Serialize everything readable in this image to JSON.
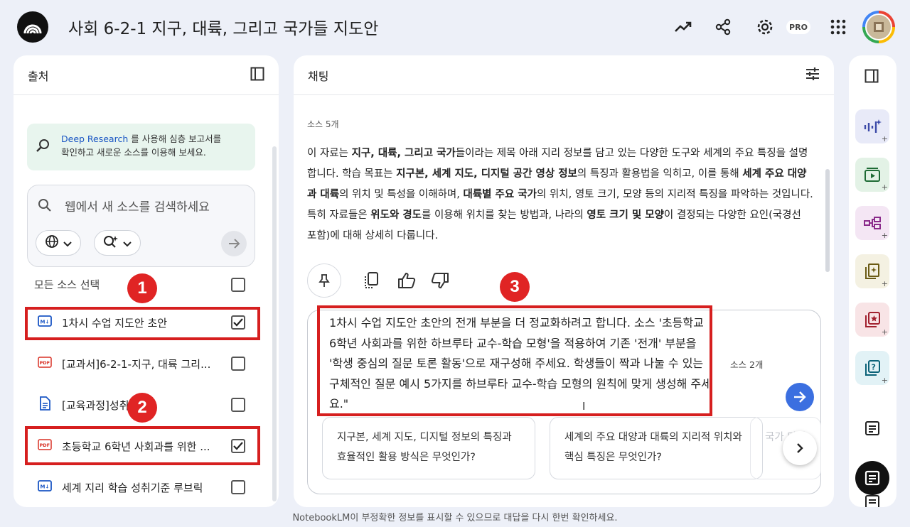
{
  "header": {
    "title": "사회 6-2-1 지구, 대륙, 그리고 국가들 지도안",
    "pro_label": "PRO"
  },
  "sources": {
    "title": "출처",
    "deep_research": {
      "link": "Deep Research",
      "text_1": " 를 사용해 심층 보고서를",
      "text_2": "확인하고 새로운 소스를 이용해 보세요."
    },
    "search_placeholder": "웹에서 새 소스를 검색하세요",
    "select_all": "모든 소스 선택",
    "items": [
      {
        "label": "1차시 수업 지도안 초안",
        "type": "md",
        "checked": true
      },
      {
        "label": "[교과서]6-2-1-지구, 대륙 그리...",
        "type": "pdf",
        "checked": false
      },
      {
        "label": "[교육과정]성취",
        "type": "doc",
        "checked": false
      },
      {
        "label": "초등학교 6학년 사회과를 위한 ...",
        "type": "pdf",
        "checked": true
      },
      {
        "label": "세계 지리 학습 성취기준 루브릭",
        "type": "md",
        "checked": false
      }
    ]
  },
  "chat": {
    "title": "채팅",
    "source_count": "소스 5개",
    "summary": [
      {
        "t": "이 자료는 ",
        "b": false
      },
      {
        "t": "지구, 대륙, 그리고 국가",
        "b": true
      },
      {
        "t": "들이라는 제목 아래 지리 정보를 담고 있는 다양한 도구와 세계의 주요 특징을 설명합니다. 학습 목표는 ",
        "b": false
      },
      {
        "t": "지구본, 세계 지도, 디지털 공간 영상 정보",
        "b": true
      },
      {
        "t": "의 특징과 활용법을 익히고, 이를 통해 ",
        "b": false
      },
      {
        "t": "세계 주요 대양과 대륙",
        "b": true
      },
      {
        "t": "의 위치 및 특성을 이해하며, ",
        "b": false
      },
      {
        "t": "대륙별 주요 국가",
        "b": true
      },
      {
        "t": "의 위치, 영토 크기, 모양 등의 지리적 특징을 파악하는 것입니다. 특히 자료들은 ",
        "b": false
      },
      {
        "t": "위도와 경도",
        "b": true
      },
      {
        "t": "를 이용해 위치를 찾는 방법과, 나라의 ",
        "b": false
      },
      {
        "t": "영토 크기 및 모양",
        "b": true
      },
      {
        "t": "이 결정되는 다양한 요인(국경선 포함)에 대해 상세히 다룹니다.",
        "b": false
      }
    ],
    "composer_text": "1차시 수업 지도안 초안의 전개 부분을 더 정교화하려고 합니다. 소스 '초등학교 6학년 사회과를 위한 하브루타 교수-학습 모형'을 적용하여 기존 '전개' 부분을 '학생 중심의 질문 토론 활동'으로 재구성해 주세요. 학생들이 짝과 나눌 수 있는 구체적인 질문 예시 5가지를 하브루타 교수-학습 모형의 원칙에 맞게 생성해 주세요.\"",
    "composer_source_count": "소스 2개",
    "suggestions": [
      "지구본, 세계 지도, 디지털 정보의 특징과 효율적인 활용 방식은 무엇인가?",
      "세계의 주요 대양과 대륙의 지리적 위치와 핵심 특징은 무엇인가?",
      "국가 다양"
    ]
  },
  "annotations": [
    "1",
    "2",
    "3"
  ],
  "footer": "NotebookLM이 부정확한 정보를 표시할 수 있으므로 대답을 다시 한번 확인하세요.",
  "colors": {
    "accent": "#3b6fe0",
    "annotation_red": "#d61f1f",
    "background": "#edf0f8"
  }
}
